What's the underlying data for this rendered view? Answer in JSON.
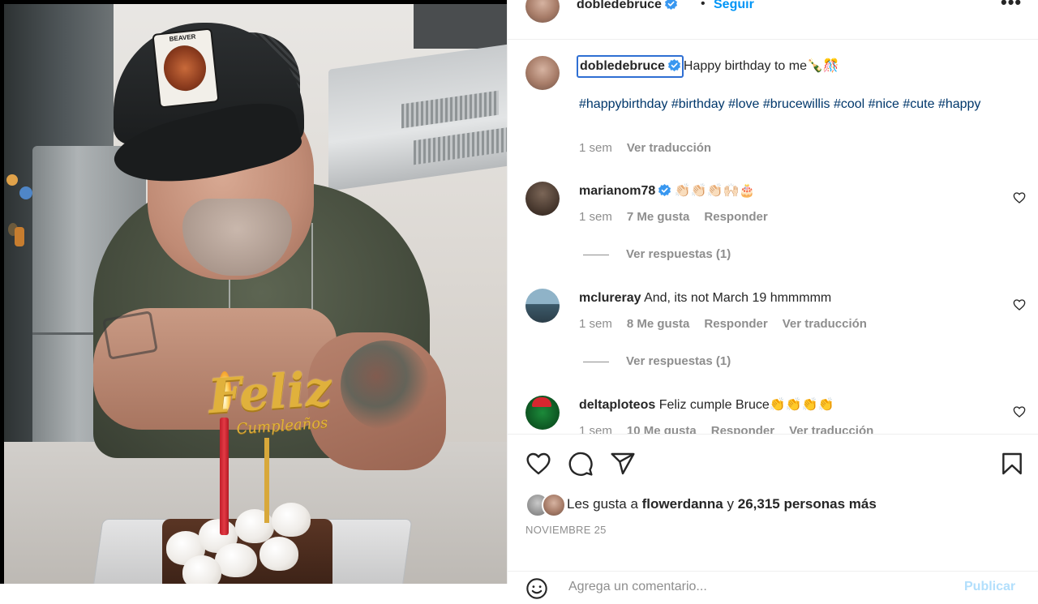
{
  "post_author": {
    "username": "dobledebruce",
    "verified": true,
    "separator": "•",
    "follow_label": "Seguir",
    "more_label": "•••"
  },
  "photo": {
    "cap_patch_text": "BEAVER",
    "topper_text": "Feliz",
    "topper_subtext": "Cumpleaños"
  },
  "caption": {
    "username": "dobledebruce",
    "text": "Happy birthday to me🍾🎊",
    "hashtags": "#happybirthday #birthday #love #brucewillis #cool #nice #cute #happy",
    "time": "1 sem",
    "translate_label": "Ver traducción"
  },
  "comments": [
    {
      "username": "marianom78",
      "verified": true,
      "text": "👏🏻👏🏻👏🏻🙌🏻🎂",
      "time": "1 sem",
      "likes": "7 Me gusta",
      "reply_label": "Responder",
      "translate_label": "",
      "view_replies": "Ver respuestas (1)"
    },
    {
      "username": "mclureray",
      "verified": false,
      "text": "And, its not March 19 hmmmmm",
      "time": "1 sem",
      "likes": "8 Me gusta",
      "reply_label": "Responder",
      "translate_label": "Ver traducción",
      "view_replies": "Ver respuestas (1)"
    },
    {
      "username": "deltaploteos",
      "verified": false,
      "text": "Feliz cumple Bruce👏👏👏👏",
      "time": "1 sem",
      "likes": "10 Me gusta",
      "reply_label": "Responder",
      "translate_label": "Ver traducción"
    }
  ],
  "likes": {
    "prefix": "Les gusta a",
    "user": "flowerdanna",
    "connector": "y",
    "count_text": "26,315 personas más"
  },
  "date": "NOVIEMBRE 25",
  "comment_box": {
    "placeholder": "Agrega un comentario...",
    "publish_label": "Publicar"
  },
  "colors": {
    "link_blue": "#0095f6",
    "hashtag_blue": "#00376b",
    "muted_gray": "#8e8e8e",
    "text_dark": "#262626",
    "verified_blue": "#3897f0",
    "selection_outline": "#2f6fd3"
  },
  "icons": {
    "like": "heart-icon",
    "comment": "comment-bubble-icon",
    "share": "paper-plane-icon",
    "save": "bookmark-icon",
    "verified": "verified-badge-icon",
    "more": "more-options-icon",
    "emoji": "emoji-smile-icon"
  }
}
